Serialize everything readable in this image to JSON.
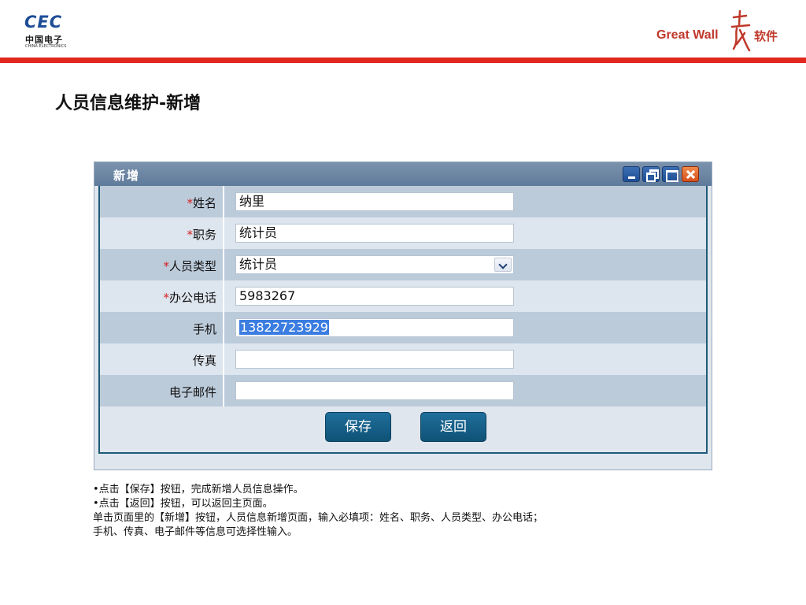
{
  "header": {
    "cec_logo": {
      "main": "CEC",
      "cn": "中国电子",
      "en": "CHINA ELECTRONICS"
    },
    "gw_logo": {
      "text": "Great Wall",
      "cn": "软件"
    },
    "colors": {
      "brand_red": "#e0281c",
      "brand_blue": "#1d4d97"
    }
  },
  "page_title": "人员信息维护-新增",
  "dialog": {
    "title": "新增",
    "window_buttons": [
      "minimize-icon",
      "restore-icon",
      "maximize-icon",
      "close-icon"
    ],
    "fields": [
      {
        "label": "姓名",
        "required": true,
        "value": "纳里",
        "type": "text"
      },
      {
        "label": "职务",
        "required": true,
        "value": "统计员",
        "type": "text"
      },
      {
        "label": "人员类型",
        "required": true,
        "value": "统计员",
        "type": "select"
      },
      {
        "label": "办公电话",
        "required": true,
        "value": "5983267",
        "type": "text"
      },
      {
        "label": "手机",
        "required": false,
        "value": "13822723929",
        "type": "text",
        "selected": true
      },
      {
        "label": "传真",
        "required": false,
        "value": "",
        "type": "text"
      },
      {
        "label": "电子邮件",
        "required": false,
        "value": "",
        "type": "text"
      }
    ],
    "buttons": {
      "save": "保存",
      "back": "返回"
    }
  },
  "notes": [
    "•点击【保存】按钮，完成新增人员信息操作。",
    "•点击【返回】按钮，可以返回主页面。",
    "单击页面里的【新增】按钮，人员信息新增页面，输入必填项：姓名、职务、人员类型、办公电话；",
    "手机、传真、电子邮件等信息可选择性输入。"
  ],
  "required_mark": "*"
}
